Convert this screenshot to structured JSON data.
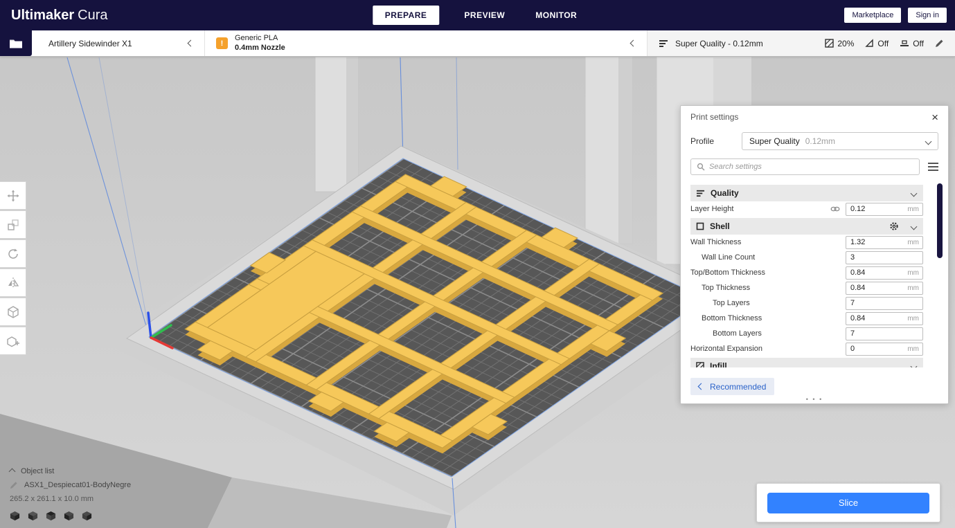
{
  "colors": {
    "topbar_navy": "#15123e",
    "accent_blue": "#3282ff",
    "model_yellow": "#f6c85a",
    "warning_orange": "#f5a12b"
  },
  "topbar": {
    "brand_bold": "Ultimaker",
    "brand_light": "Cura",
    "tabs": [
      {
        "label": "PREPARE"
      },
      {
        "label": "PREVIEW"
      },
      {
        "label": "MONITOR"
      }
    ],
    "marketplace_label": "Marketplace",
    "signin_label": "Sign in"
  },
  "configbar": {
    "printer_name": "Artillery Sidewinder X1",
    "material_name": "Generic PLA",
    "nozzle_label": "0.4mm Nozzle",
    "profile_summary": "Super Quality - 0.12mm",
    "infill_value": "20%",
    "support_value": "Off",
    "adhesion_value": "Off"
  },
  "print_settings": {
    "title": "Print settings",
    "profile_label": "Profile",
    "profile_value": "Super Quality",
    "profile_hint": "0.12mm",
    "search_placeholder": "Search settings",
    "categories": {
      "quality": "Quality",
      "shell": "Shell",
      "infill": "Infill"
    },
    "rows": [
      {
        "label": "Layer Height",
        "value": "0.12",
        "unit": "mm"
      },
      {
        "label": "Wall Thickness",
        "value": "1.32",
        "unit": "mm"
      },
      {
        "label": "Wall Line Count",
        "value": "3",
        "unit": ""
      },
      {
        "label": "Top/Bottom Thickness",
        "value": "0.84",
        "unit": "mm"
      },
      {
        "label": "Top Thickness",
        "value": "0.84",
        "unit": "mm"
      },
      {
        "label": "Top Layers",
        "value": "7",
        "unit": ""
      },
      {
        "label": "Bottom Thickness",
        "value": "0.84",
        "unit": "mm"
      },
      {
        "label": "Bottom Layers",
        "value": "7",
        "unit": ""
      },
      {
        "label": "Horizontal Expansion",
        "value": "0",
        "unit": "mm"
      }
    ],
    "recommended_label": "Recommended"
  },
  "object_list": {
    "toggle_label": "Object list",
    "item_name": "ASX1_Despiecat01-BodyNegre",
    "dimensions": "265.2 x 261.1 x 10.0 mm"
  },
  "slice": {
    "button_label": "Slice"
  },
  "icons": {
    "close": "×",
    "dots": "• • •",
    "material_warning": "!"
  }
}
